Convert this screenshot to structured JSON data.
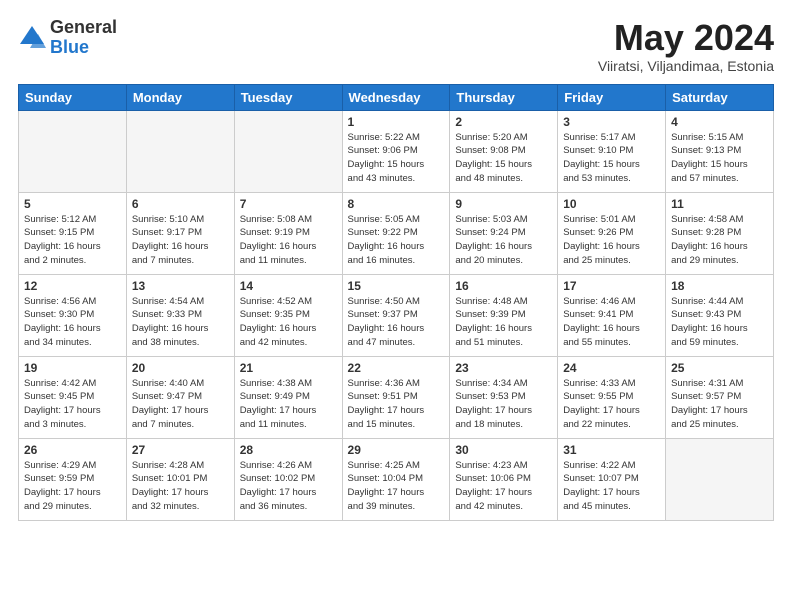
{
  "logo": {
    "general": "General",
    "blue": "Blue"
  },
  "title": "May 2024",
  "subtitle": "Viiratsi, Viljandimaa, Estonia",
  "headers": [
    "Sunday",
    "Monday",
    "Tuesday",
    "Wednesday",
    "Thursday",
    "Friday",
    "Saturday"
  ],
  "weeks": [
    [
      {
        "num": "",
        "info": ""
      },
      {
        "num": "",
        "info": ""
      },
      {
        "num": "",
        "info": ""
      },
      {
        "num": "1",
        "info": "Sunrise: 5:22 AM\nSunset: 9:06 PM\nDaylight: 15 hours\nand 43 minutes."
      },
      {
        "num": "2",
        "info": "Sunrise: 5:20 AM\nSunset: 9:08 PM\nDaylight: 15 hours\nand 48 minutes."
      },
      {
        "num": "3",
        "info": "Sunrise: 5:17 AM\nSunset: 9:10 PM\nDaylight: 15 hours\nand 53 minutes."
      },
      {
        "num": "4",
        "info": "Sunrise: 5:15 AM\nSunset: 9:13 PM\nDaylight: 15 hours\nand 57 minutes."
      }
    ],
    [
      {
        "num": "5",
        "info": "Sunrise: 5:12 AM\nSunset: 9:15 PM\nDaylight: 16 hours\nand 2 minutes."
      },
      {
        "num": "6",
        "info": "Sunrise: 5:10 AM\nSunset: 9:17 PM\nDaylight: 16 hours\nand 7 minutes."
      },
      {
        "num": "7",
        "info": "Sunrise: 5:08 AM\nSunset: 9:19 PM\nDaylight: 16 hours\nand 11 minutes."
      },
      {
        "num": "8",
        "info": "Sunrise: 5:05 AM\nSunset: 9:22 PM\nDaylight: 16 hours\nand 16 minutes."
      },
      {
        "num": "9",
        "info": "Sunrise: 5:03 AM\nSunset: 9:24 PM\nDaylight: 16 hours\nand 20 minutes."
      },
      {
        "num": "10",
        "info": "Sunrise: 5:01 AM\nSunset: 9:26 PM\nDaylight: 16 hours\nand 25 minutes."
      },
      {
        "num": "11",
        "info": "Sunrise: 4:58 AM\nSunset: 9:28 PM\nDaylight: 16 hours\nand 29 minutes."
      }
    ],
    [
      {
        "num": "12",
        "info": "Sunrise: 4:56 AM\nSunset: 9:30 PM\nDaylight: 16 hours\nand 34 minutes."
      },
      {
        "num": "13",
        "info": "Sunrise: 4:54 AM\nSunset: 9:33 PM\nDaylight: 16 hours\nand 38 minutes."
      },
      {
        "num": "14",
        "info": "Sunrise: 4:52 AM\nSunset: 9:35 PM\nDaylight: 16 hours\nand 42 minutes."
      },
      {
        "num": "15",
        "info": "Sunrise: 4:50 AM\nSunset: 9:37 PM\nDaylight: 16 hours\nand 47 minutes."
      },
      {
        "num": "16",
        "info": "Sunrise: 4:48 AM\nSunset: 9:39 PM\nDaylight: 16 hours\nand 51 minutes."
      },
      {
        "num": "17",
        "info": "Sunrise: 4:46 AM\nSunset: 9:41 PM\nDaylight: 16 hours\nand 55 minutes."
      },
      {
        "num": "18",
        "info": "Sunrise: 4:44 AM\nSunset: 9:43 PM\nDaylight: 16 hours\nand 59 minutes."
      }
    ],
    [
      {
        "num": "19",
        "info": "Sunrise: 4:42 AM\nSunset: 9:45 PM\nDaylight: 17 hours\nand 3 minutes."
      },
      {
        "num": "20",
        "info": "Sunrise: 4:40 AM\nSunset: 9:47 PM\nDaylight: 17 hours\nand 7 minutes."
      },
      {
        "num": "21",
        "info": "Sunrise: 4:38 AM\nSunset: 9:49 PM\nDaylight: 17 hours\nand 11 minutes."
      },
      {
        "num": "22",
        "info": "Sunrise: 4:36 AM\nSunset: 9:51 PM\nDaylight: 17 hours\nand 15 minutes."
      },
      {
        "num": "23",
        "info": "Sunrise: 4:34 AM\nSunset: 9:53 PM\nDaylight: 17 hours\nand 18 minutes."
      },
      {
        "num": "24",
        "info": "Sunrise: 4:33 AM\nSunset: 9:55 PM\nDaylight: 17 hours\nand 22 minutes."
      },
      {
        "num": "25",
        "info": "Sunrise: 4:31 AM\nSunset: 9:57 PM\nDaylight: 17 hours\nand 25 minutes."
      }
    ],
    [
      {
        "num": "26",
        "info": "Sunrise: 4:29 AM\nSunset: 9:59 PM\nDaylight: 17 hours\nand 29 minutes."
      },
      {
        "num": "27",
        "info": "Sunrise: 4:28 AM\nSunset: 10:01 PM\nDaylight: 17 hours\nand 32 minutes."
      },
      {
        "num": "28",
        "info": "Sunrise: 4:26 AM\nSunset: 10:02 PM\nDaylight: 17 hours\nand 36 minutes."
      },
      {
        "num": "29",
        "info": "Sunrise: 4:25 AM\nSunset: 10:04 PM\nDaylight: 17 hours\nand 39 minutes."
      },
      {
        "num": "30",
        "info": "Sunrise: 4:23 AM\nSunset: 10:06 PM\nDaylight: 17 hours\nand 42 minutes."
      },
      {
        "num": "31",
        "info": "Sunrise: 4:22 AM\nSunset: 10:07 PM\nDaylight: 17 hours\nand 45 minutes."
      },
      {
        "num": "",
        "info": ""
      }
    ]
  ]
}
